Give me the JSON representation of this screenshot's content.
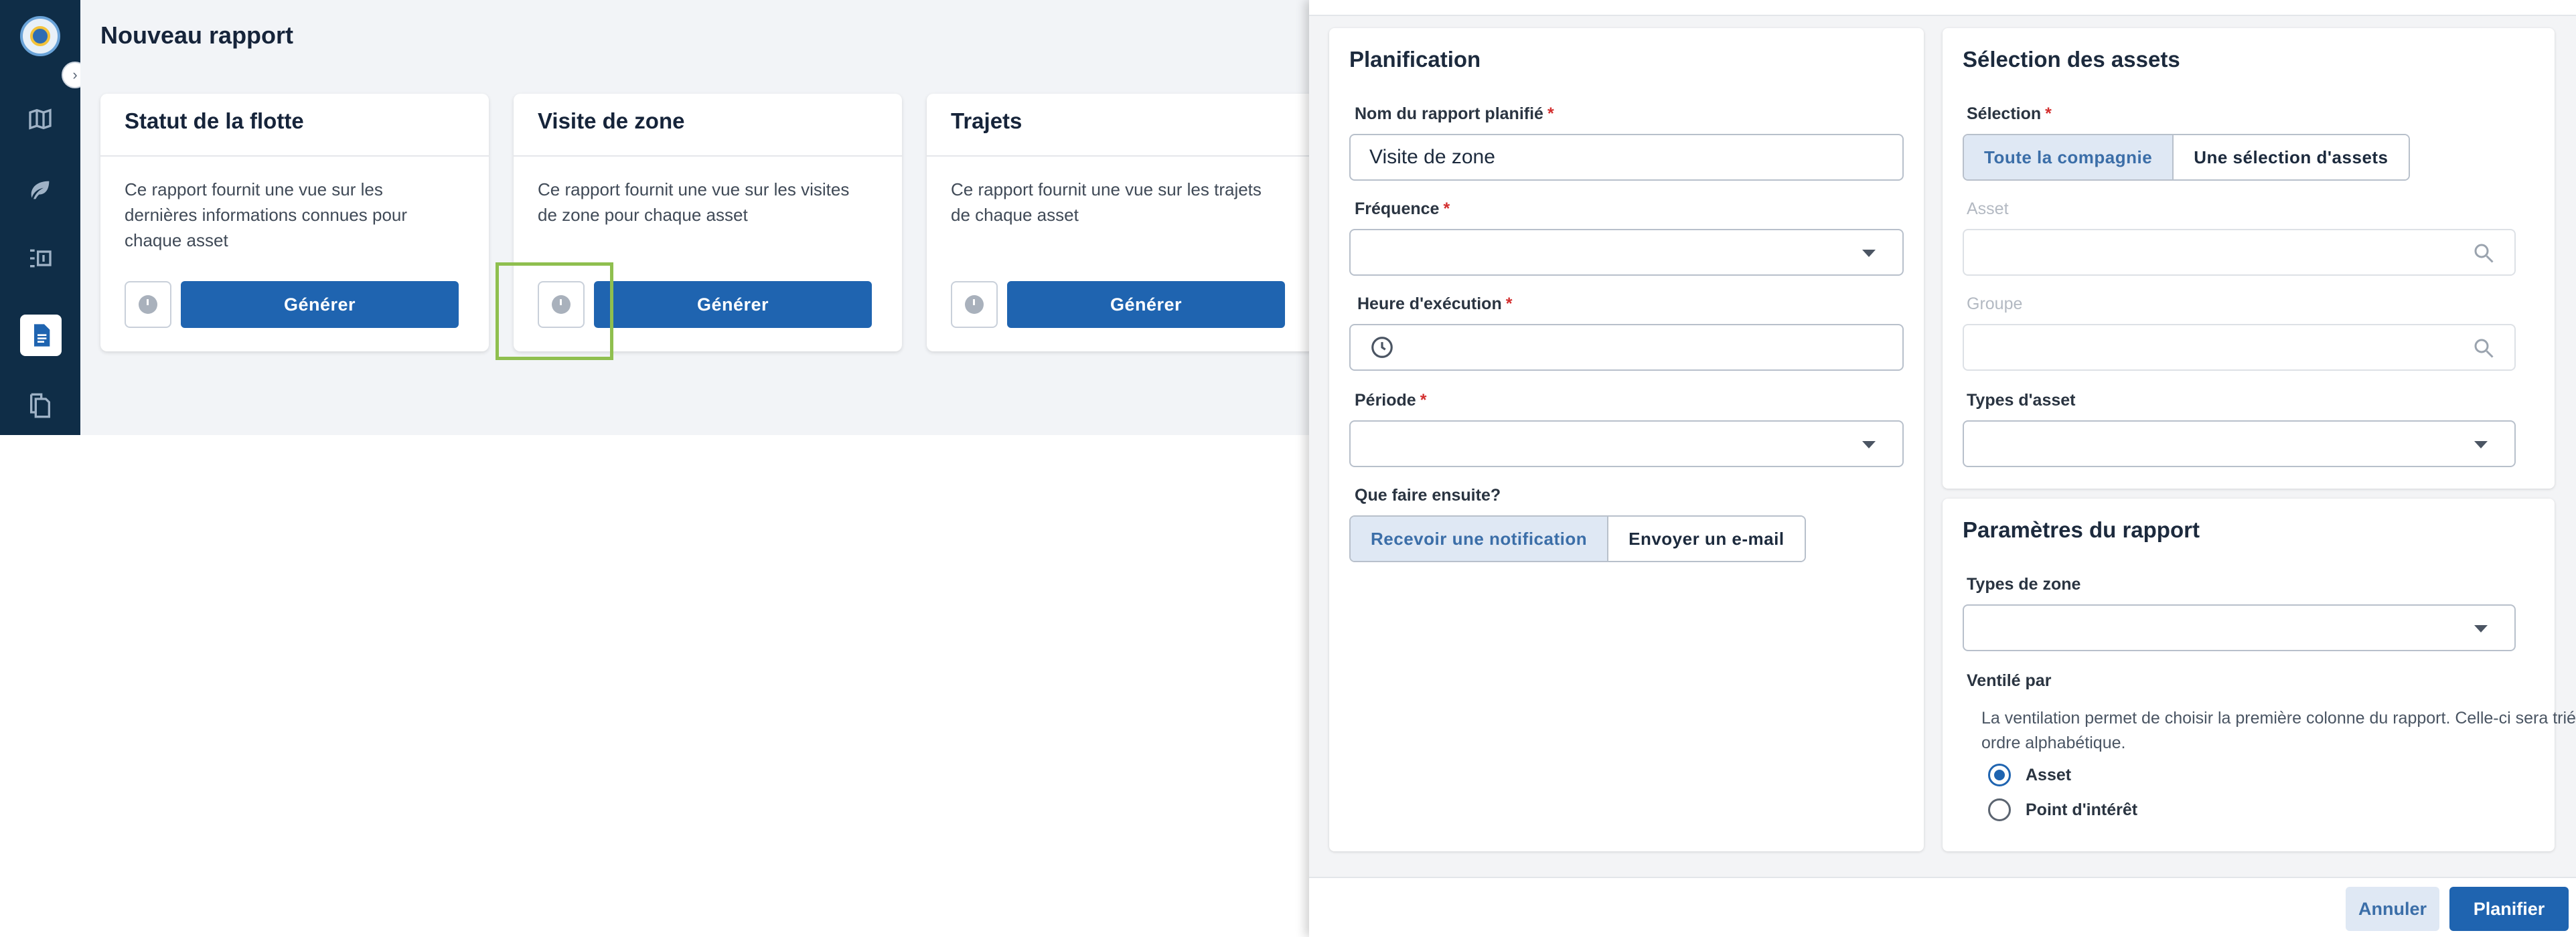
{
  "page": {
    "title": "Nouveau rapport"
  },
  "sidebar": {
    "items": [
      {
        "icon": "map-icon"
      },
      {
        "icon": "leaf-icon"
      },
      {
        "icon": "route-list-icon"
      },
      {
        "icon": "report-icon",
        "active": true
      },
      {
        "icon": "documents-icon"
      }
    ]
  },
  "cards": [
    {
      "title": "Statut de la flotte",
      "description": "Ce rapport fournit une vue sur les dernières informations connues pour chaque asset",
      "button": "Générer"
    },
    {
      "title": "Visite de zone",
      "description": "Ce rapport fournit une vue sur les visites de zone pour chaque asset",
      "button": "Générer"
    },
    {
      "title": "Trajets",
      "description": "Ce rapport fournit une vue sur les trajets de chaque asset",
      "button": "Générer"
    }
  ],
  "planning": {
    "title": "Planification",
    "name_label": "Nom du rapport planifié",
    "name_value": "Visite de zone",
    "frequency_label": "Fréquence",
    "frequency_value": "",
    "time_label": "Heure d'exécution",
    "time_value": "",
    "period_label": "Période",
    "period_value": "",
    "next_label": "Que faire ensuite?",
    "next_options": [
      "Recevoir une notification",
      "Envoyer un e-mail"
    ],
    "next_selected": "Recevoir une notification"
  },
  "assets": {
    "title": "Sélection des assets",
    "selection_label": "Sélection",
    "selection_options": [
      "Toute la compagnie",
      "Une sélection d'assets"
    ],
    "selection_selected": "Toute la compagnie",
    "asset_label": "Asset",
    "group_label": "Groupe",
    "types_label": "Types d'asset"
  },
  "params": {
    "title": "Paramètres du rapport",
    "zone_types_label": "Types de zone",
    "breakdown_label": "Ventilé par",
    "breakdown_hint": "La ventilation permet de choisir la première colonne du rapport. Celle-ci sera triée par ordre alphabétique.",
    "breakdown_options": [
      "Asset",
      "Point d'intérêt"
    ],
    "breakdown_selected": "Asset"
  },
  "footer": {
    "cancel": "Annuler",
    "submit": "Planifier"
  },
  "colors": {
    "primary": "#1f64b0",
    "sidebar": "#0f2d47",
    "required": "#d32f2f",
    "highlight": "#8fbf4f"
  }
}
